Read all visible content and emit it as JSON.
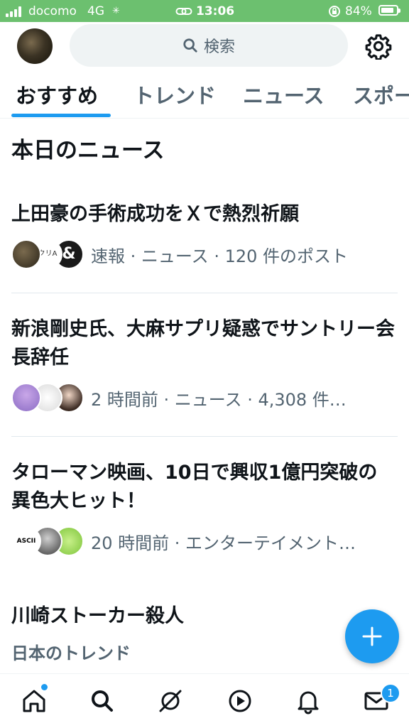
{
  "status_bar": {
    "carrier": "docomo",
    "network": "4G",
    "time": "13:06",
    "battery": "84%",
    "battery_level": 0.84,
    "background": "#6cc06f"
  },
  "header": {
    "search_placeholder": "検索",
    "avatar_icon": "profile-avatar",
    "settings_icon": "gear-icon"
  },
  "tabs": [
    {
      "label": "おすすめ",
      "active": true
    },
    {
      "label": "トレンド",
      "active": false
    },
    {
      "label": "ニュース",
      "active": false
    },
    {
      "label": "スポー",
      "active": false
    }
  ],
  "section_title": "本日のニュース",
  "news": [
    {
      "title": "上田豪の手術成功をＸで熱烈祈願",
      "meta": "速報 · ニュース · 120 件のポスト"
    },
    {
      "title": "新浪剛史氏、大麻サプリ疑惑でサントリー会長辞任",
      "meta": "2 時間前 · ニュース · 4,308 件…"
    },
    {
      "title": "タローマン映画、10日で興収1億円突破の異色大ヒット！",
      "meta": "20 時間前 · エンターテイメント…"
    }
  ],
  "avatars": {
    "row1_label2": "クリA",
    "row1_label3": "&",
    "row3_label1": "ASCII"
  },
  "trend": {
    "title": "川崎ストーカー殺人",
    "subtitle": "日本のトレンド"
  },
  "fab_icon": "compose-plus-icon",
  "bottom_nav": {
    "items": [
      "home-icon",
      "search-icon",
      "grok-icon",
      "play-icon",
      "bell-icon",
      "mail-icon"
    ],
    "messages_badge": "1"
  },
  "colors": {
    "accent": "#1d9bf0",
    "text": "#0f1419",
    "secondary": "#536471"
  }
}
